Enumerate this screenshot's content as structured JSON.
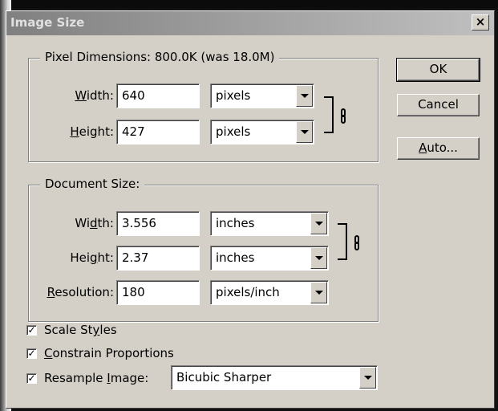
{
  "window": {
    "title": "Image Size",
    "close_glyph": "×"
  },
  "pixel_dimensions": {
    "legend": "Pixel Dimensions:  800.0K (was 18.0M)",
    "width": {
      "label_pre": "",
      "label_u": "W",
      "label_post": "idth:",
      "value": "640",
      "unit": "pixels"
    },
    "height": {
      "label_pre": "",
      "label_u": "H",
      "label_post": "eight:",
      "value": "427",
      "unit": "pixels"
    }
  },
  "document_size": {
    "legend": "Document Size:",
    "width": {
      "label_pre": "Wi",
      "label_u": "d",
      "label_post": "th:",
      "value": "3.556",
      "unit": "inches"
    },
    "height": {
      "label_pre": "Hei",
      "label_u": "g",
      "label_post": "ht:",
      "value": "2.37",
      "unit": "inches"
    },
    "resolution": {
      "label_pre": "",
      "label_u": "R",
      "label_post": "esolution:",
      "value": "180",
      "unit": "pixels/inch"
    }
  },
  "buttons": {
    "ok": "OK",
    "cancel": "Cancel",
    "auto": {
      "pre": "",
      "u": "A",
      "post": "uto..."
    }
  },
  "options": {
    "scale_styles": {
      "pre": "Scale St",
      "u": "y",
      "post": "les",
      "checked": true
    },
    "constrain": {
      "pre": "",
      "u": "C",
      "post": "onstrain Proportions",
      "checked": true
    },
    "resample": {
      "pre": "Resample ",
      "u": "I",
      "post": "mage:",
      "checked": true,
      "method": "Bicubic Sharper"
    }
  },
  "check_glyph": "✓",
  "icons": {
    "link": "chain-link-icon",
    "dropdown": "triangle-down-icon"
  }
}
